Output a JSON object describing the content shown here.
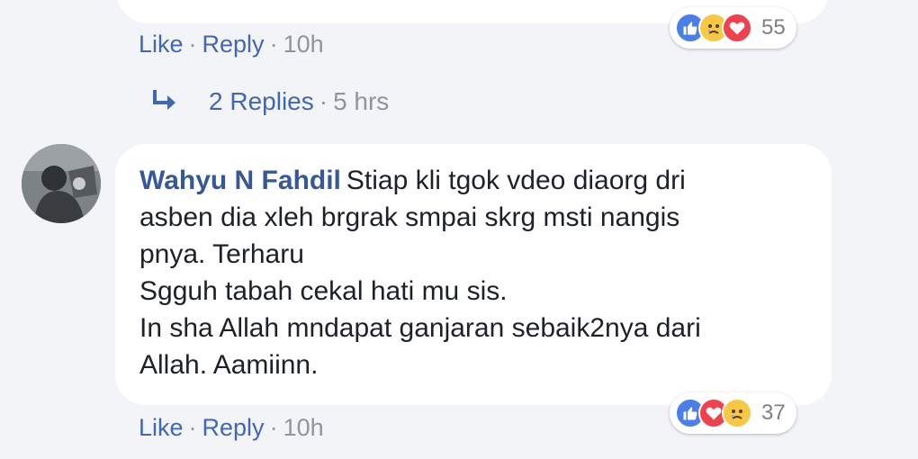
{
  "previous_comment": {
    "actions": {
      "like": "Like",
      "reply": "Reply",
      "separator": "·",
      "time": "10h"
    },
    "reactions": {
      "types": [
        "like-icon",
        "sad-icon",
        "love-icon"
      ],
      "count": "55"
    }
  },
  "replies_summary": {
    "label": "2 Replies",
    "separator": "·",
    "time": "5 hrs"
  },
  "comment": {
    "author": "Wahyu N Fahdil",
    "lines": [
      "Stiap kli tgok vdeo diaorg dri",
      "asben dia xleh brgrak smpai skrg msti nangis",
      "pnya. Terharu",
      "Sgguh tabah cekal hati mu sis.",
      "In sha Allah mndapat ganjaran sebaik2nya dari",
      "Allah. Aamiinn."
    ],
    "actions": {
      "like": "Like",
      "reply": "Reply",
      "separator": "·",
      "time": "10h"
    },
    "reactions": {
      "types": [
        "like-icon",
        "love-icon",
        "sad-icon"
      ],
      "count": "37"
    }
  },
  "colors": {
    "background": "#f3f4f7",
    "link": "#4267b2",
    "author": "#365899",
    "text": "#1d2129",
    "muted": "#90949c",
    "like": "#4a7fe8",
    "love": "#f0414f",
    "sad": "#f7c844"
  }
}
